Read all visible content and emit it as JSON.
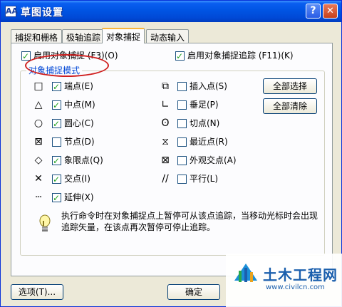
{
  "window": {
    "title": "草图设置",
    "app_icon_glyph": "AA",
    "help_glyph": "?",
    "close_glyph": "✕"
  },
  "tabs": [
    {
      "label": "捕捉和栅格",
      "active": false
    },
    {
      "label": "极轴追踪",
      "active": false
    },
    {
      "label": "对象捕捉",
      "active": true
    },
    {
      "label": "动态输入",
      "active": false
    }
  ],
  "osnap_on": {
    "label": "启用对象捕捉 (F3)(O)",
    "checked": true
  },
  "osnap_track": {
    "label": "启用对象捕捉追踪 (F11)(K)",
    "checked": true
  },
  "group": {
    "title": "对象捕捉模式",
    "left": [
      {
        "symbol": "□",
        "label": "端点(E)",
        "checked": true
      },
      {
        "symbol": "△",
        "label": "中点(M)",
        "checked": true
      },
      {
        "symbol": "○",
        "label": "圆心(C)",
        "checked": true
      },
      {
        "symbol": "⊠",
        "label": "节点(D)",
        "checked": false
      },
      {
        "symbol": "◇",
        "label": "象限点(Q)",
        "checked": true
      },
      {
        "symbol": "✕",
        "label": "交点(I)",
        "checked": true
      },
      {
        "symbol": "┄",
        "label": "延伸(X)",
        "checked": true
      }
    ],
    "right": [
      {
        "symbol": "⧉",
        "label": "插入点(S)",
        "checked": false
      },
      {
        "symbol": "∟",
        "label": "垂足(P)",
        "checked": false
      },
      {
        "symbol": "ʘ",
        "label": "切点(N)",
        "checked": false
      },
      {
        "symbol": "⧖",
        "label": "最近点(R)",
        "checked": false
      },
      {
        "symbol": "⊠",
        "label": "外观交点(A)",
        "checked": false
      },
      {
        "symbol": "∕∕",
        "label": "平行(L)",
        "checked": false
      }
    ],
    "select_all": "全部选择",
    "clear_all": "全部清除"
  },
  "hint": "执行命令时在对象捕捉点上暂停可从该点追踪，当移动光标时会出现追踪矢量，在该点再次暂停可停止追踪。",
  "footer": {
    "options": "选项(T)...",
    "ok": "确定"
  },
  "watermark": {
    "name": "土木工程网",
    "url": "www.civilcn.com"
  }
}
